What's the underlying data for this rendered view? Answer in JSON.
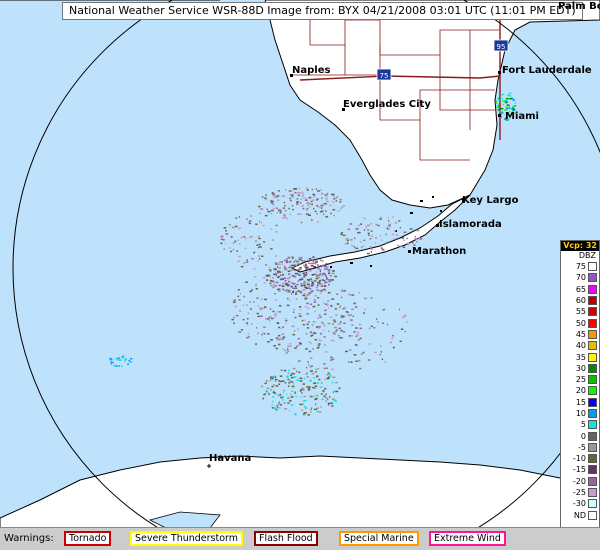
{
  "title": "National Weather Service WSR-88D Image from: BYX 04/21/2008 03:01 UTC (11:01 PM EDT)",
  "cities": {
    "naples": "Naples",
    "everglades_city": "Everglades City",
    "fort_lauderdale": "Fort Lauderdale",
    "miami": "Miami",
    "palm_beach": "Palm Beach",
    "key_largo": "Key Largo",
    "islamorada": "Islamorada",
    "marathon": "Marathon",
    "havana": "Havana"
  },
  "highways": {
    "i75": "75",
    "i95": "95"
  },
  "legend": {
    "vcp": "Vcp: 32",
    "unit": "DBZ",
    "levels": [
      {
        "label": "75",
        "color": "#ffffff"
      },
      {
        "label": "70",
        "color": "#9854c6"
      },
      {
        "label": "65",
        "color": "#f800fd"
      },
      {
        "label": "60",
        "color": "#bc0000"
      },
      {
        "label": "55",
        "color": "#d40000"
      },
      {
        "label": "50",
        "color": "#fd0000"
      },
      {
        "label": "45",
        "color": "#fd9500"
      },
      {
        "label": "40",
        "color": "#e5bc00"
      },
      {
        "label": "35",
        "color": "#fdf802"
      },
      {
        "label": "30",
        "color": "#008e00"
      },
      {
        "label": "25",
        "color": "#01c501"
      },
      {
        "label": "20",
        "color": "#02fd02"
      },
      {
        "label": "15",
        "color": "#0300f4"
      },
      {
        "label": "10",
        "color": "#019ff4"
      },
      {
        "label": "5",
        "color": "#04e9e7"
      },
      {
        "label": "0",
        "color": "#646464"
      },
      {
        "label": "-5",
        "color": "#999999"
      },
      {
        "label": "-10",
        "color": "#666633"
      },
      {
        "label": "-15",
        "color": "#663366"
      },
      {
        "label": "-20",
        "color": "#996699"
      },
      {
        "label": "-25",
        "color": "#cc99cc"
      },
      {
        "label": "-30",
        "color": "#ccffff"
      },
      {
        "label": "ND",
        "color": "#ffffff"
      }
    ]
  },
  "warnings": {
    "label": "Warnings:",
    "items": [
      {
        "label": "Tornado",
        "color": "#cc0000"
      },
      {
        "label": "Severe Thunderstorm",
        "color": "#ffff00"
      },
      {
        "label": "Flash Flood",
        "color": "#8b0000"
      },
      {
        "label": "Special Marine",
        "color": "#ff9900"
      },
      {
        "label": "Extreme Wind",
        "color": "#ff1493"
      }
    ]
  },
  "colors": {
    "water": "#bfe2fc",
    "land": "#ffffff",
    "county_lines": "#8b1a1a",
    "coast": "#000000"
  }
}
